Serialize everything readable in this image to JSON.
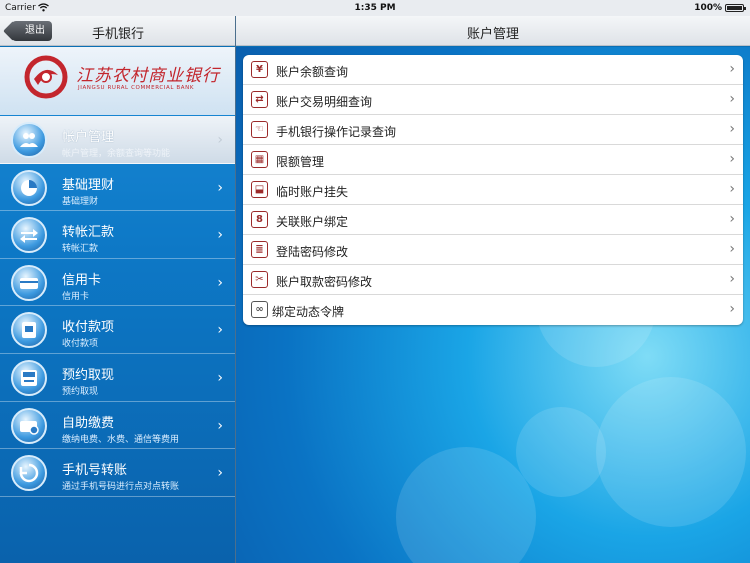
{
  "status_bar": {
    "carrier": "Carrier",
    "time": "1:35 PM",
    "battery": "100%"
  },
  "left_nav": {
    "back_label": "退出",
    "title": "手机银行"
  },
  "right_nav": {
    "title": "账户管理"
  },
  "logo": {
    "name_cn": "江苏农村商业银行",
    "name_en": "JIANGSU RURAL COMMERCIAL BANK"
  },
  "menu": [
    {
      "label": "帐户管理",
      "sub": "帐户管理，余额查询等功能",
      "icon": "users-icon",
      "active": true
    },
    {
      "label": "基础理财",
      "sub": "基础理财",
      "icon": "pie-chart-icon"
    },
    {
      "label": "转帐汇款",
      "sub": "转帐汇款",
      "icon": "transfer-arrows-icon"
    },
    {
      "label": "信用卡",
      "sub": "信用卡",
      "icon": "credit-card-icon"
    },
    {
      "label": "收付款项",
      "sub": "收付款项",
      "icon": "payment-icon"
    },
    {
      "label": "预约取现",
      "sub": "预约取现",
      "icon": "atm-icon"
    },
    {
      "label": "自助缴费",
      "sub": "缴纳电费、水费、通信等费用",
      "icon": "wallet-icon"
    },
    {
      "label": "手机号转账",
      "sub": "通过手机号码进行点对点转账",
      "icon": "phone-transfer-icon"
    }
  ],
  "account_options": [
    {
      "label": "账户余额查询",
      "icon_glyph": "¥",
      "icon": "yuan-icon"
    },
    {
      "label": "账户交易明细查询",
      "icon_glyph": "⇄",
      "icon": "exchange-icon"
    },
    {
      "label": "手机银行操作记录查询",
      "icon_glyph": "☜",
      "icon": "touch-record-icon"
    },
    {
      "label": "限额管理",
      "icon_glyph": "▦",
      "icon": "calculator-icon"
    },
    {
      "label": "临时账户挂失",
      "icon_glyph": "⬓",
      "icon": "lock-icon"
    },
    {
      "label": "关联账户绑定",
      "icon_glyph": "8",
      "icon": "link-icon"
    },
    {
      "label": "登陆密码修改",
      "icon_glyph": "≣",
      "icon": "password-icon"
    },
    {
      "label": "账户取款密码修改",
      "icon_glyph": "✂",
      "icon": "scissors-icon"
    },
    {
      "label": "绑定动态令牌",
      "icon_glyph": "∞",
      "icon": "token-icon"
    }
  ],
  "colors": {
    "accent": "#9b2a2a",
    "panel_blue": "#0d78c6",
    "nav_bar": "#dfe3e8"
  }
}
